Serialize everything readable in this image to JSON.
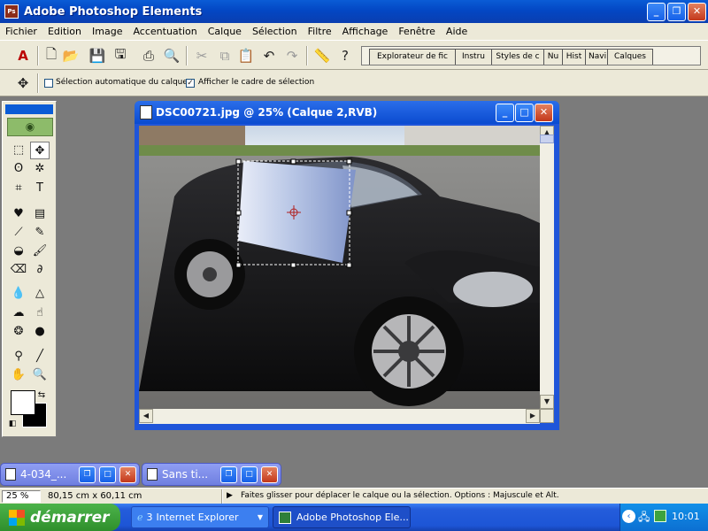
{
  "app": {
    "title": "Adobe Photoshop Elements",
    "icon_text": "Ps"
  },
  "menu": [
    "Fichier",
    "Edition",
    "Image",
    "Accentuation",
    "Calque",
    "Sélection",
    "Filtre",
    "Affichage",
    "Fenêtre",
    "Aide"
  ],
  "palette_tabs": [
    "Explorateur de fic",
    "Instru",
    "Styles de c",
    "Nu",
    "Hist",
    "Navi",
    "Calques"
  ],
  "options": {
    "auto_select": "Sélection automatique du calque",
    "show_bbox": "Afficher le cadre de sélection"
  },
  "document": {
    "title": "DSC00721.jpg @ 25% (Calque  2,RVB)"
  },
  "minimized": [
    {
      "label": "4-034_..."
    },
    {
      "label": "Sans ti..."
    }
  ],
  "status": {
    "zoom": "25 %",
    "size": "80,15 cm x 60,11 cm",
    "hint": "Faites glisser pour déplacer le calque ou la sélection. Options : Majuscule et Alt."
  },
  "taskbar": {
    "start": "démarrer",
    "ie_count": "3",
    "ie_label": "Internet Explorer",
    "ps_label": "Adobe Photoshop Ele...",
    "clock": "10:01"
  },
  "colors": {
    "title_blue": "#0a4bd0",
    "chrome": "#ece9d8",
    "workspace": "#7b7b7b",
    "start_green": "#2f8f2c"
  }
}
